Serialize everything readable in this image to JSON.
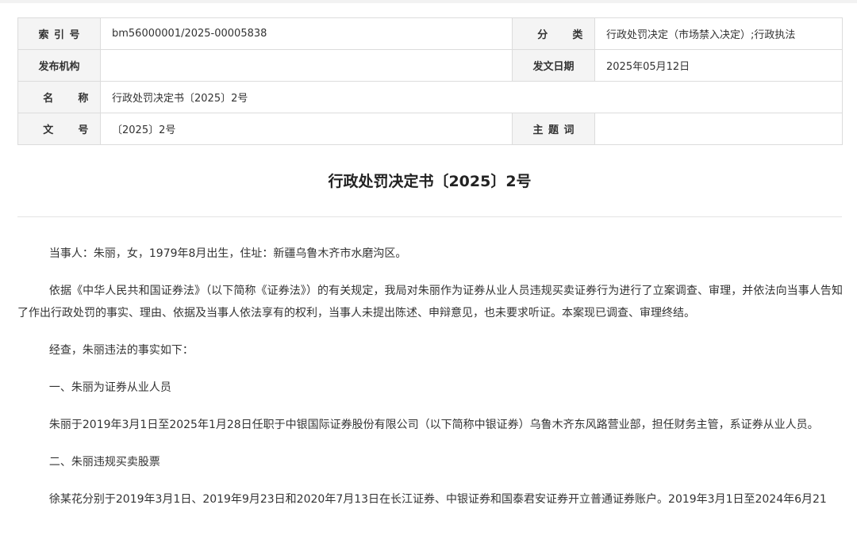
{
  "meta": {
    "index_label": "索引号",
    "index_value": "bm56000001/2025-00005838",
    "category_label": "分类",
    "category_value": "行政处罚决定（市场禁入决定）;行政执法",
    "issuer_label": "发布机构",
    "issuer_value": "",
    "date_label": "发文日期",
    "date_value": "2025年05月12日",
    "name_label": "名称",
    "name_value": "行政处罚决定书〔2025〕2号",
    "docno_label": "文号",
    "docno_value": "〔2025〕2号",
    "keywords_label": "主题词",
    "keywords_value": ""
  },
  "document": {
    "title": "行政处罚决定书〔2025〕2号",
    "paragraphs": [
      "当事人：朱丽，女，1979年8月出生，住址：新疆乌鲁木齐市水磨沟区。",
      "依据《中华人民共和国证券法》（以下简称《证券法》）的有关规定，我局对朱丽作为证券从业人员违规买卖证券行为进行了立案调查、审理，并依法向当事人告知了作出行政处罚的事实、理由、依据及当事人依法享有的权利，当事人未提出陈述、申辩意见，也未要求听证。本案现已调查、审理终结。",
      "经查，朱丽违法的事实如下：",
      "一、朱丽为证券从业人员",
      "朱丽于2019年3月1日至2025年1月28日任职于中银国际证券股份有限公司（以下简称中银证券）乌鲁木齐东风路营业部，担任财务主管，系证券从业人员。",
      "二、朱丽违规买卖股票",
      "徐某花分别于2019年3月1日、2019年9月23日和2020年7月13日在长江证券、中银证券和国泰君安证券开立普通证券账户。2019年3月1日至2024年6月21"
    ]
  }
}
